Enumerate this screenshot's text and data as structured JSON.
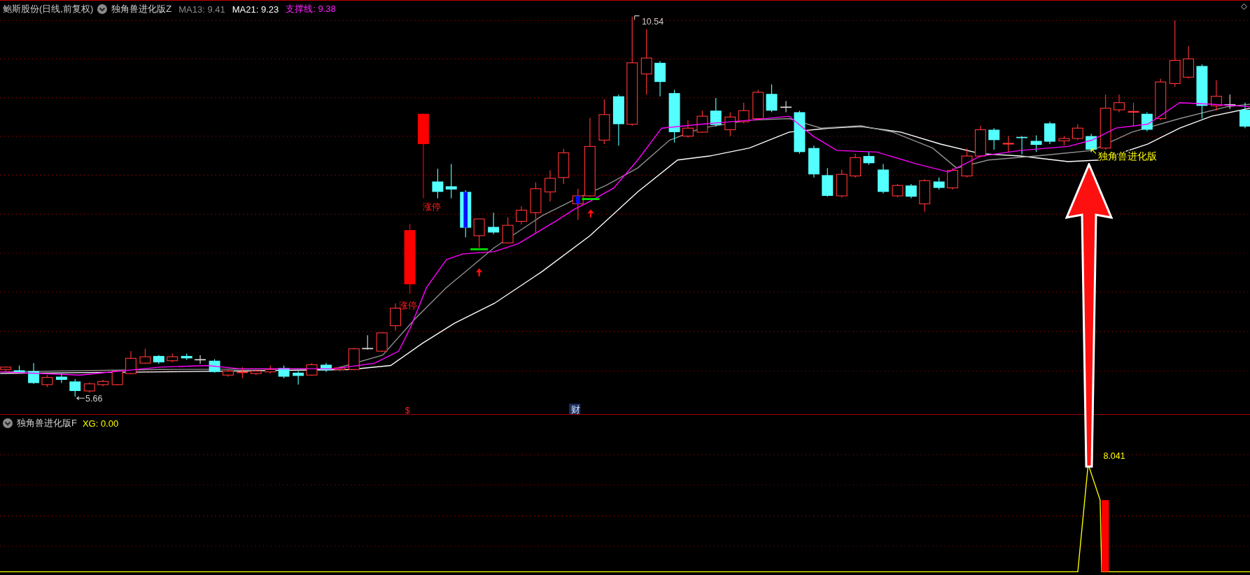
{
  "price_panel": {
    "header": {
      "stock": "鲍斯股份(日线,前复权)",
      "indicator": "独角兽进化版Z",
      "ma13": "MA13: 9.41",
      "ma21": "MA21: 9.23",
      "support": "支撑线: 9.38"
    },
    "high_label": "10.54",
    "low_label": "5.66",
    "limit_up_labels": [
      "涨停",
      "涨停"
    ],
    "signal_label": "独角兽进化版",
    "markers": [
      {
        "kind": "dollar",
        "text": "$"
      },
      {
        "kind": "finance",
        "text": "财"
      }
    ]
  },
  "indicator_panel": {
    "header": {
      "name": "独角兽进化版F",
      "xg": "XG: 0.00"
    },
    "peak_label": "8.041"
  }
}
